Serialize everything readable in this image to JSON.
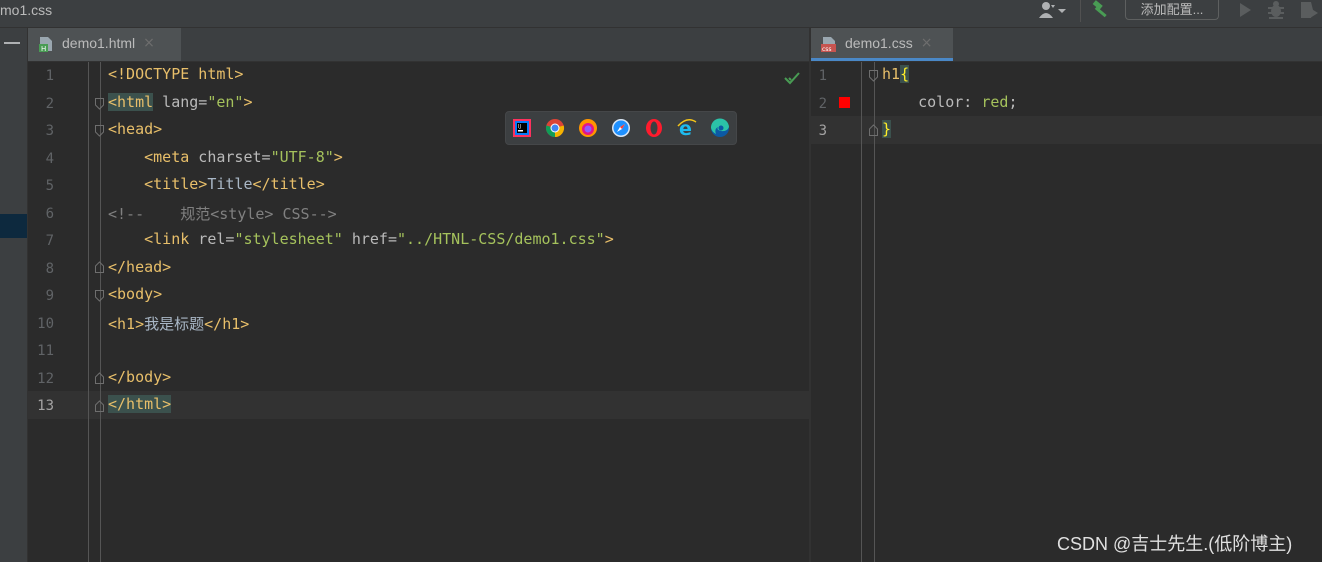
{
  "window": {
    "title": "mo1.css"
  },
  "toolbar": {
    "config_button": "添加配置..."
  },
  "tabs": {
    "left": {
      "label": "demo1.html",
      "close": "×"
    },
    "right": {
      "label": "demo1.css",
      "close": "×"
    }
  },
  "html_editor": {
    "line_numbers": [
      "1",
      "2",
      "3",
      "4",
      "5",
      "6",
      "7",
      "8",
      "9",
      "10",
      "11",
      "12",
      "13"
    ],
    "lines": [
      {
        "parts": [
          "<!DOCTYPE html>"
        ]
      },
      {
        "parts": [
          "<html",
          " lang=",
          "\"en\"",
          ">"
        ]
      },
      {
        "parts": [
          "<head>"
        ]
      },
      {
        "parts": [
          "    ",
          "<meta",
          " charset=",
          "\"UTF-8\"",
          ">"
        ]
      },
      {
        "parts": [
          "    ",
          "<title>",
          "Title",
          "</title>"
        ]
      },
      {
        "parts": [
          "<!--    规范<style> CSS-->"
        ]
      },
      {
        "parts": [
          "    ",
          "<link",
          " rel=",
          "\"stylesheet\"",
          " href=",
          "\"../HTNL-CSS/demo1.css\"",
          ">"
        ]
      },
      {
        "parts": [
          "</head>"
        ]
      },
      {
        "parts": [
          "<body>"
        ]
      },
      {
        "parts": [
          "<h1>",
          "我是标题",
          "</h1>"
        ]
      },
      {
        "parts": [
          ""
        ]
      },
      {
        "parts": [
          "</body>"
        ]
      },
      {
        "parts": [
          "</html>"
        ]
      }
    ]
  },
  "css_editor": {
    "line_numbers": [
      "1",
      "2",
      "3"
    ],
    "line1": {
      "selector": "h1",
      "brace": "{"
    },
    "line2": {
      "indent": "    ",
      "prop": "color",
      "colon": ": ",
      "value": "red",
      "semi": ";"
    },
    "line3": {
      "brace": "}"
    },
    "color_swatch": "#ff0000"
  },
  "browser_icons": [
    "intellij-icon",
    "chrome-icon",
    "firefox-icon",
    "safari-icon",
    "opera-icon",
    "ie-icon",
    "edge-icon"
  ],
  "watermark": "CSDN @吉士先生.(低阶博主)"
}
